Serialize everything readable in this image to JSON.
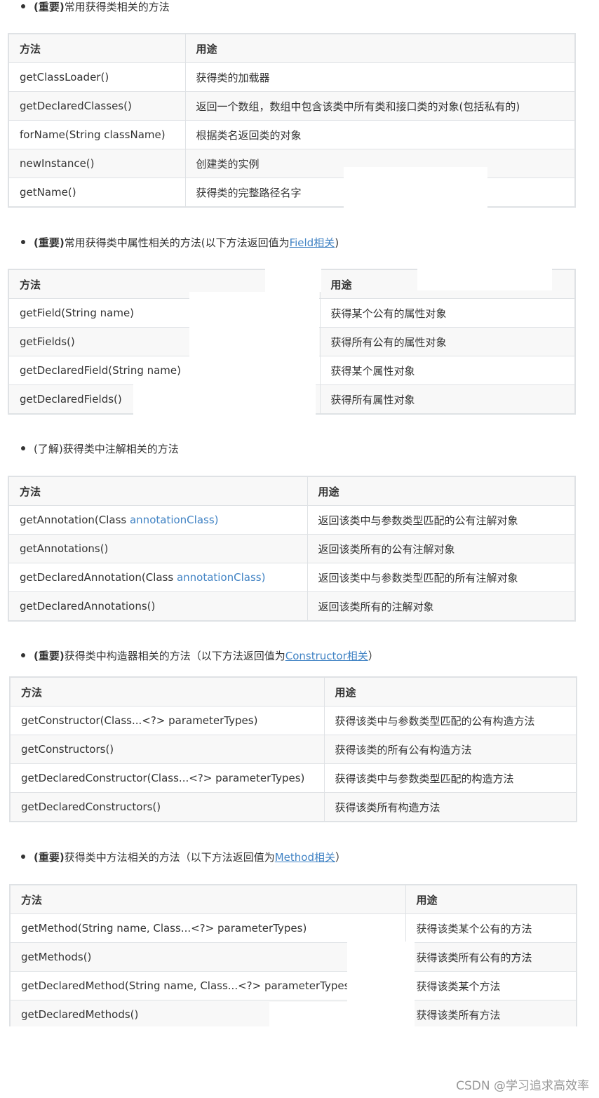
{
  "sections": [
    {
      "heading_bold": "(重要)",
      "heading_text": "常用获得类相关的方法",
      "heading_link": "",
      "heading_suffix": "",
      "headers": [
        "方法",
        "用途"
      ],
      "rows": [
        [
          "getClassLoader()",
          "获得类的加载器"
        ],
        [
          "getDeclaredClasses()",
          "返回一个数组，数组中包含该类中所有类和接口类的对象(包括私有的)"
        ],
        [
          "forName(String className)",
          "根据类名返回类的对象"
        ],
        [
          "newInstance()",
          "创建类的实例"
        ],
        [
          "getName()",
          "获得类的完整路径名字"
        ]
      ]
    },
    {
      "heading_bold": "(重要)",
      "heading_text": "常用获得类中属性相关的方法(以下方法返回值为",
      "heading_link": "Field相关",
      "heading_suffix": ")",
      "headers": [
        "方法",
        "用途"
      ],
      "rows": [
        [
          "getField(String name)",
          "获得某个公有的属性对象"
        ],
        [
          "getFields()",
          "获得所有公有的属性对象"
        ],
        [
          "getDeclaredField(String name)",
          "获得某个属性对象"
        ],
        [
          "getDeclaredFields()",
          "获得所有属性对象"
        ]
      ]
    },
    {
      "heading_bold": "",
      "heading_text": "(了解)获得类中注解相关的方法",
      "heading_link": "",
      "heading_suffix": "",
      "headers": [
        "方法",
        "用途"
      ],
      "rows": [
        [
          "getAnnotation(Class ",
          "annotationClass)",
          "返回该类中与参数类型匹配的公有注解对象"
        ],
        [
          "getAnnotations()",
          "",
          "返回该类所有的公有注解对象"
        ],
        [
          "getDeclaredAnnotation(Class ",
          "annotationClass)",
          "返回该类中与参数类型匹配的所有注解对象"
        ],
        [
          "getDeclaredAnnotations()",
          "",
          "返回该类所有的注解对象"
        ]
      ]
    },
    {
      "heading_bold": "(重要)",
      "heading_text": "获得类中构造器相关的方法（以下方法返回值为",
      "heading_link": "Constructor相关",
      "heading_suffix": "）",
      "headers": [
        "方法",
        "用途"
      ],
      "rows": [
        [
          "getConstructor(Class...<?> parameterTypes)",
          "获得该类中与参数类型匹配的公有构造方法"
        ],
        [
          "getConstructors()",
          "获得该类的所有公有构造方法"
        ],
        [
          "getDeclaredConstructor(Class...<?> parameterTypes)",
          "获得该类中与参数类型匹配的构造方法"
        ],
        [
          "getDeclaredConstructors()",
          "获得该类所有构造方法"
        ]
      ]
    },
    {
      "heading_bold": "(重要)",
      "heading_text": "获得类中方法相关的方法（以下方法返回值为",
      "heading_link": "Method相关",
      "heading_suffix": "）",
      "headers": [
        "方法",
        "用途"
      ],
      "rows": [
        [
          "getMethod(String name, Class...<?> parameterTypes)",
          "获得该类某个公有的方法"
        ],
        [
          "getMethods()",
          "获得该类所有公有的方法"
        ],
        [
          "getDeclaredMethod(String name, Class...<?> parameterTypes)",
          "获得该类某个方法"
        ],
        [
          "getDeclaredMethods()",
          "获得该类所有方法"
        ]
      ]
    }
  ],
  "watermark": "CSDN @学习追求高效率"
}
